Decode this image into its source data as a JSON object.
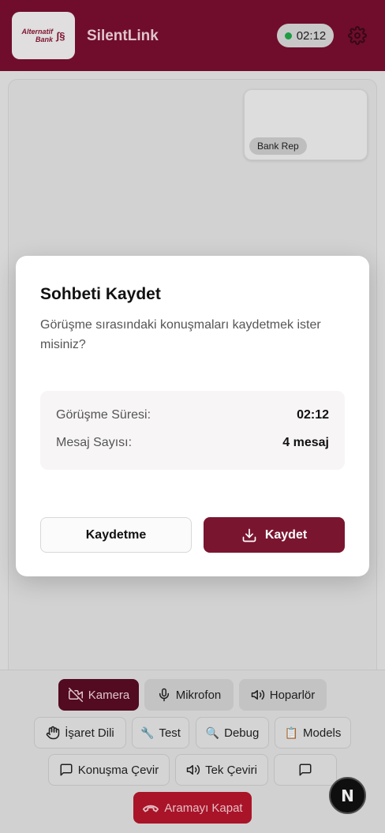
{
  "header": {
    "logo_line1": "Alternatif",
    "logo_line2": "Bank",
    "app_name": "SilentLink",
    "timer": "02:12"
  },
  "video": {
    "remote_label": "Bank Rep"
  },
  "controls": {
    "row1": [
      "Kamera",
      "Mikrofon",
      "Hoparlör"
    ],
    "row2": [
      "İşaret Dili",
      "Test",
      "Debug",
      "Models"
    ],
    "row3": [
      "Konuşma Çevir",
      "Tek Çeviri"
    ],
    "end_call": "Aramayı Kapat",
    "badge": "N"
  },
  "modal": {
    "title": "Sohbeti Kaydet",
    "description": "Görüşme sırasındaki konuşmaları kaydetmek ister misiniz?",
    "duration_label": "Görüşme Süresi:",
    "duration_value": "02:12",
    "count_label": "Mesaj Sayısı:",
    "count_value": "4 mesaj",
    "cancel_label": "Kaydetme",
    "save_label": "Kaydet"
  },
  "colors": {
    "brand": "#7a0f30",
    "active_button": "#5a0c24",
    "end_call": "#b8162c",
    "status_online": "#1faa4b"
  }
}
